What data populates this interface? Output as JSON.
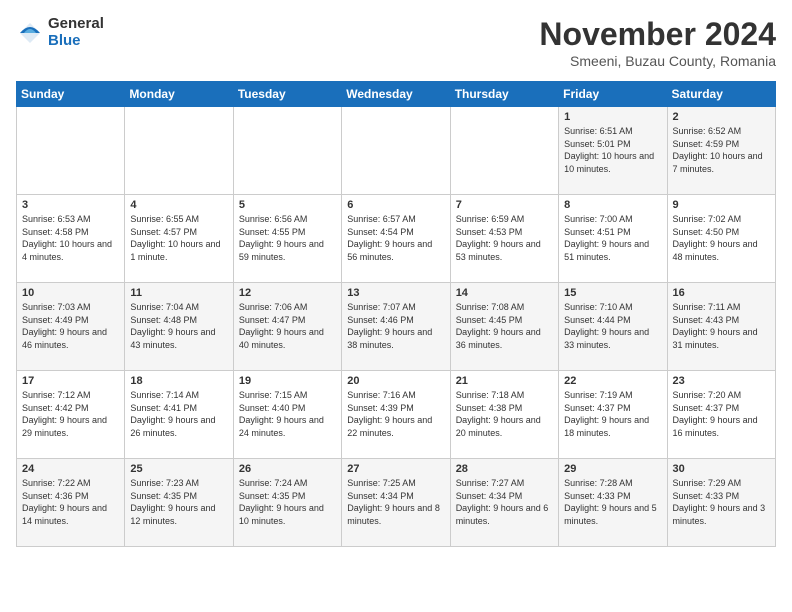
{
  "logo": {
    "general": "General",
    "blue": "Blue"
  },
  "title": "November 2024",
  "subtitle": "Smeeni, Buzau County, Romania",
  "weekdays": [
    "Sunday",
    "Monday",
    "Tuesday",
    "Wednesday",
    "Thursday",
    "Friday",
    "Saturday"
  ],
  "weeks": [
    [
      {
        "day": "",
        "sunrise": "",
        "sunset": "",
        "daylight": ""
      },
      {
        "day": "",
        "sunrise": "",
        "sunset": "",
        "daylight": ""
      },
      {
        "day": "",
        "sunrise": "",
        "sunset": "",
        "daylight": ""
      },
      {
        "day": "",
        "sunrise": "",
        "sunset": "",
        "daylight": ""
      },
      {
        "day": "",
        "sunrise": "",
        "sunset": "",
        "daylight": ""
      },
      {
        "day": "1",
        "sunrise": "Sunrise: 6:51 AM",
        "sunset": "Sunset: 5:01 PM",
        "daylight": "Daylight: 10 hours and 10 minutes."
      },
      {
        "day": "2",
        "sunrise": "Sunrise: 6:52 AM",
        "sunset": "Sunset: 4:59 PM",
        "daylight": "Daylight: 10 hours and 7 minutes."
      }
    ],
    [
      {
        "day": "3",
        "sunrise": "Sunrise: 6:53 AM",
        "sunset": "Sunset: 4:58 PM",
        "daylight": "Daylight: 10 hours and 4 minutes."
      },
      {
        "day": "4",
        "sunrise": "Sunrise: 6:55 AM",
        "sunset": "Sunset: 4:57 PM",
        "daylight": "Daylight: 10 hours and 1 minute."
      },
      {
        "day": "5",
        "sunrise": "Sunrise: 6:56 AM",
        "sunset": "Sunset: 4:55 PM",
        "daylight": "Daylight: 9 hours and 59 minutes."
      },
      {
        "day": "6",
        "sunrise": "Sunrise: 6:57 AM",
        "sunset": "Sunset: 4:54 PM",
        "daylight": "Daylight: 9 hours and 56 minutes."
      },
      {
        "day": "7",
        "sunrise": "Sunrise: 6:59 AM",
        "sunset": "Sunset: 4:53 PM",
        "daylight": "Daylight: 9 hours and 53 minutes."
      },
      {
        "day": "8",
        "sunrise": "Sunrise: 7:00 AM",
        "sunset": "Sunset: 4:51 PM",
        "daylight": "Daylight: 9 hours and 51 minutes."
      },
      {
        "day": "9",
        "sunrise": "Sunrise: 7:02 AM",
        "sunset": "Sunset: 4:50 PM",
        "daylight": "Daylight: 9 hours and 48 minutes."
      }
    ],
    [
      {
        "day": "10",
        "sunrise": "Sunrise: 7:03 AM",
        "sunset": "Sunset: 4:49 PM",
        "daylight": "Daylight: 9 hours and 46 minutes."
      },
      {
        "day": "11",
        "sunrise": "Sunrise: 7:04 AM",
        "sunset": "Sunset: 4:48 PM",
        "daylight": "Daylight: 9 hours and 43 minutes."
      },
      {
        "day": "12",
        "sunrise": "Sunrise: 7:06 AM",
        "sunset": "Sunset: 4:47 PM",
        "daylight": "Daylight: 9 hours and 40 minutes."
      },
      {
        "day": "13",
        "sunrise": "Sunrise: 7:07 AM",
        "sunset": "Sunset: 4:46 PM",
        "daylight": "Daylight: 9 hours and 38 minutes."
      },
      {
        "day": "14",
        "sunrise": "Sunrise: 7:08 AM",
        "sunset": "Sunset: 4:45 PM",
        "daylight": "Daylight: 9 hours and 36 minutes."
      },
      {
        "day": "15",
        "sunrise": "Sunrise: 7:10 AM",
        "sunset": "Sunset: 4:44 PM",
        "daylight": "Daylight: 9 hours and 33 minutes."
      },
      {
        "day": "16",
        "sunrise": "Sunrise: 7:11 AM",
        "sunset": "Sunset: 4:43 PM",
        "daylight": "Daylight: 9 hours and 31 minutes."
      }
    ],
    [
      {
        "day": "17",
        "sunrise": "Sunrise: 7:12 AM",
        "sunset": "Sunset: 4:42 PM",
        "daylight": "Daylight: 9 hours and 29 minutes."
      },
      {
        "day": "18",
        "sunrise": "Sunrise: 7:14 AM",
        "sunset": "Sunset: 4:41 PM",
        "daylight": "Daylight: 9 hours and 26 minutes."
      },
      {
        "day": "19",
        "sunrise": "Sunrise: 7:15 AM",
        "sunset": "Sunset: 4:40 PM",
        "daylight": "Daylight: 9 hours and 24 minutes."
      },
      {
        "day": "20",
        "sunrise": "Sunrise: 7:16 AM",
        "sunset": "Sunset: 4:39 PM",
        "daylight": "Daylight: 9 hours and 22 minutes."
      },
      {
        "day": "21",
        "sunrise": "Sunrise: 7:18 AM",
        "sunset": "Sunset: 4:38 PM",
        "daylight": "Daylight: 9 hours and 20 minutes."
      },
      {
        "day": "22",
        "sunrise": "Sunrise: 7:19 AM",
        "sunset": "Sunset: 4:37 PM",
        "daylight": "Daylight: 9 hours and 18 minutes."
      },
      {
        "day": "23",
        "sunrise": "Sunrise: 7:20 AM",
        "sunset": "Sunset: 4:37 PM",
        "daylight": "Daylight: 9 hours and 16 minutes."
      }
    ],
    [
      {
        "day": "24",
        "sunrise": "Sunrise: 7:22 AM",
        "sunset": "Sunset: 4:36 PM",
        "daylight": "Daylight: 9 hours and 14 minutes."
      },
      {
        "day": "25",
        "sunrise": "Sunrise: 7:23 AM",
        "sunset": "Sunset: 4:35 PM",
        "daylight": "Daylight: 9 hours and 12 minutes."
      },
      {
        "day": "26",
        "sunrise": "Sunrise: 7:24 AM",
        "sunset": "Sunset: 4:35 PM",
        "daylight": "Daylight: 9 hours and 10 minutes."
      },
      {
        "day": "27",
        "sunrise": "Sunrise: 7:25 AM",
        "sunset": "Sunset: 4:34 PM",
        "daylight": "Daylight: 9 hours and 8 minutes."
      },
      {
        "day": "28",
        "sunrise": "Sunrise: 7:27 AM",
        "sunset": "Sunset: 4:34 PM",
        "daylight": "Daylight: 9 hours and 6 minutes."
      },
      {
        "day": "29",
        "sunrise": "Sunrise: 7:28 AM",
        "sunset": "Sunset: 4:33 PM",
        "daylight": "Daylight: 9 hours and 5 minutes."
      },
      {
        "day": "30",
        "sunrise": "Sunrise: 7:29 AM",
        "sunset": "Sunset: 4:33 PM",
        "daylight": "Daylight: 9 hours and 3 minutes."
      }
    ]
  ]
}
